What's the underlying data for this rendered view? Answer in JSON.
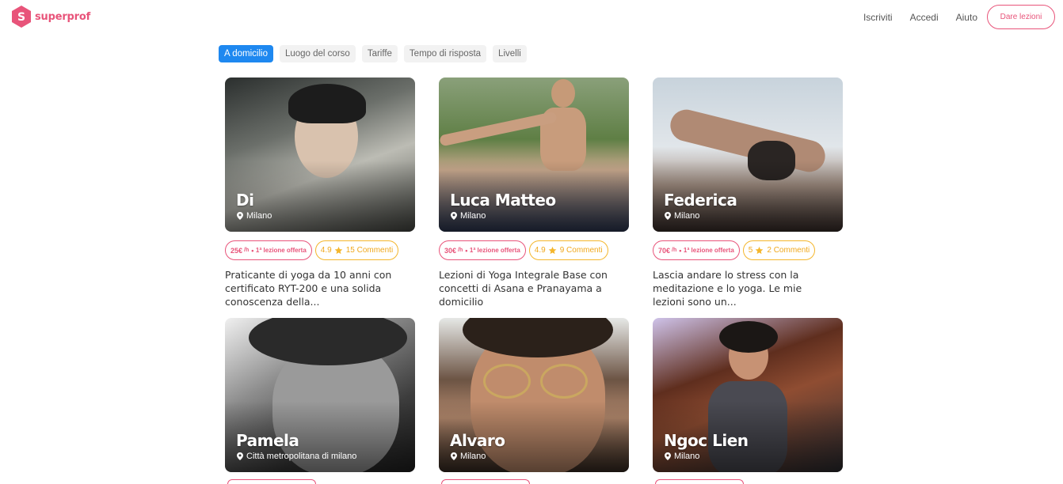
{
  "brand": {
    "name": "superprof",
    "logo_letter": "S",
    "color": "#e8547a"
  },
  "nav": {
    "signup": "Iscriviti",
    "login": "Accedi",
    "help": "Aiuto",
    "cta": "Dare lezioni"
  },
  "filters": [
    {
      "label": "A domicilio",
      "active": true
    },
    {
      "label": "Luogo del corso",
      "active": false
    },
    {
      "label": "Tariffe",
      "active": false
    },
    {
      "label": "Tempo di risposta",
      "active": false
    },
    {
      "label": "Livelli",
      "active": false
    }
  ],
  "teachers": [
    {
      "name": "Di",
      "location": "Milano",
      "price": "25€",
      "unit": "/h",
      "offer": "1ª lezione offerta",
      "rating": "4.9",
      "reviews": "15 Commenti",
      "description": "Praticante di yoga da 10 anni con certificato RYT-200 e una solida conoscenza della..."
    },
    {
      "name": "Luca Matteo",
      "location": "Milano",
      "price": "30€",
      "unit": "/h",
      "offer": "1ª lezione offerta",
      "rating": "4.9",
      "reviews": "9 Commenti",
      "description": "Lezioni di Yoga Integrale Base con concetti di Asana e Pranayama a domicilio"
    },
    {
      "name": "Federica",
      "location": "Milano",
      "price": "70€",
      "unit": "/h",
      "offer": "1ª lezione offerta",
      "rating": "5",
      "reviews": "2 Commenti",
      "description": "Lascia andare lo stress con la meditazione e lo yoga. Le mie lezioni sono un..."
    },
    {
      "name": "Pamela",
      "location": "Città metropolitana di milano"
    },
    {
      "name": "Alvaro",
      "location": "Milano"
    },
    {
      "name": "Ngoc Lien",
      "location": "Milano"
    }
  ],
  "icons": {
    "location": "map-pin-icon",
    "rating": "star-icon"
  },
  "colors": {
    "accent": "#e8547a",
    "active_filter": "#1e88f0",
    "rating": "#f4b62c"
  }
}
